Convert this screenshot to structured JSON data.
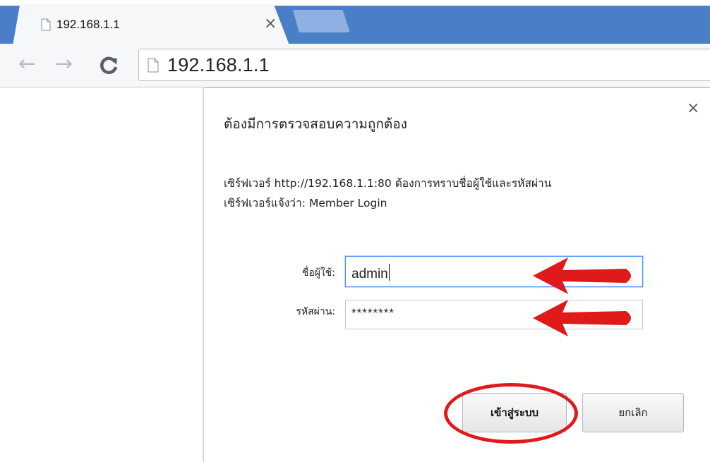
{
  "tab": {
    "title": "192.168.1.1",
    "close_icon": "close-icon"
  },
  "toolbar": {
    "back_icon": "back-arrow-icon",
    "forward_icon": "forward-arrow-icon",
    "reload_icon": "reload-icon",
    "address": "192.168.1.1"
  },
  "dialog": {
    "title": "ต้องมีการตรวจสอบความถูกต้อง",
    "message_line1": "เซิร์ฟเวอร์ http://192.168.1.1:80 ต้องการทราบชื่อผู้ใช้และรหัสผ่าน",
    "message_line2": "เซิร์ฟเวอร์แจ้งว่า: Member Login",
    "username_label": "ชื่อผู้ใช้:",
    "username_value": "admin",
    "password_label": "รหัสผ่าน:",
    "password_value": "********",
    "login_button": "เข้าสู่ระบบ",
    "cancel_button": "ยกเลิก"
  },
  "annotation_color": "#e01a1a",
  "accent_color": "#4a7fc8"
}
